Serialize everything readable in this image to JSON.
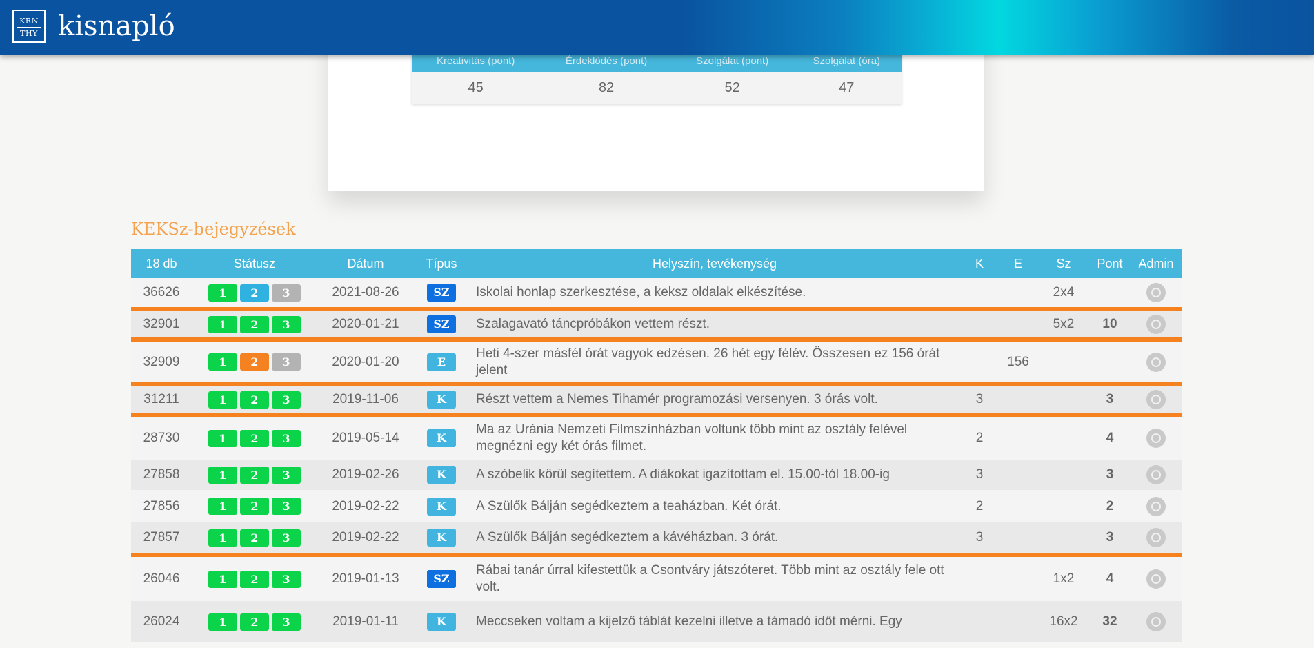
{
  "header": {
    "logo_top": "KRN",
    "logo_bottom": "THY",
    "title": "kisnapló"
  },
  "stats": {
    "headers": [
      "Kreativitás (pont)",
      "Érdeklődés (pont)",
      "Szolgálat (pont)",
      "Szolgálat (óra)"
    ],
    "values": [
      "45",
      "82",
      "52",
      "47"
    ]
  },
  "section": {
    "title": "KEKSz-bejegyzések"
  },
  "table": {
    "headers": {
      "count": "18 db",
      "status": "Státusz",
      "date": "Dátum",
      "type": "Típus",
      "desc": "Helyszín, tevékenység",
      "k": "K",
      "e": "E",
      "sz": "Sz",
      "pont": "Pont",
      "admin": "Admin"
    },
    "rows": [
      {
        "id": "36626",
        "s": [
          "1",
          "2",
          "3"
        ],
        "sc": [
          "green",
          "blue",
          "gray"
        ],
        "date": "2021-08-26",
        "type": "SZ",
        "desc": "Iskolai honlap szerkesztése, a keksz oldalak elkészítése.",
        "k": "",
        "e": "",
        "sz": "2x4",
        "pont": ""
      },
      {
        "id": "32901",
        "s": [
          "1",
          "2",
          "3"
        ],
        "sc": [
          "green",
          "green",
          "green"
        ],
        "date": "2020-01-21",
        "type": "SZ",
        "desc": "Szalagavató táncpróbákon vettem részt.",
        "k": "",
        "e": "",
        "sz": "5x2",
        "pont": "10"
      },
      {
        "id": "32909",
        "s": [
          "1",
          "2",
          "3"
        ],
        "sc": [
          "green",
          "orange",
          "gray"
        ],
        "date": "2020-01-20",
        "type": "E",
        "desc": "Heti 4-szer másfél órát vagyok edzésen. 26 hét egy félév. Összesen ez 156 órát jelent",
        "k": "",
        "e": "156",
        "sz": "",
        "pont": ""
      },
      {
        "id": "31211",
        "s": [
          "1",
          "2",
          "3"
        ],
        "sc": [
          "green",
          "green",
          "green"
        ],
        "date": "2019-11-06",
        "type": "K",
        "desc": "Részt vettem a Nemes Tihamér programozási versenyen. 3 órás volt.",
        "k": "3",
        "e": "",
        "sz": "",
        "pont": "3"
      },
      {
        "id": "28730",
        "s": [
          "1",
          "2",
          "3"
        ],
        "sc": [
          "green",
          "green",
          "green"
        ],
        "date": "2019-05-14",
        "type": "K",
        "desc": "Ma az Uránia Nemzeti Filmszínházban voltunk több mint az osztály felével megnézni egy két órás filmet.",
        "k": "2",
        "e": "",
        "sz": "",
        "pont": "4"
      },
      {
        "id": "27858",
        "s": [
          "1",
          "2",
          "3"
        ],
        "sc": [
          "green",
          "green",
          "green"
        ],
        "date": "2019-02-26",
        "type": "K",
        "desc": "A szóbelik körül segítettem. A diákokat igazítottam el. 15.00-tól 18.00-ig",
        "k": "3",
        "e": "",
        "sz": "",
        "pont": "3"
      },
      {
        "id": "27856",
        "s": [
          "1",
          "2",
          "3"
        ],
        "sc": [
          "green",
          "green",
          "green"
        ],
        "date": "2019-02-22",
        "type": "K",
        "desc": "A Szülők Bálján segédkeztem a teaházban. Két órát.",
        "k": "2",
        "e": "",
        "sz": "",
        "pont": "2"
      },
      {
        "id": "27857",
        "s": [
          "1",
          "2",
          "3"
        ],
        "sc": [
          "green",
          "green",
          "green"
        ],
        "date": "2019-02-22",
        "type": "K",
        "desc": "A Szülők Bálján segédkeztem a kávéházban. 3 órát.",
        "k": "3",
        "e": "",
        "sz": "",
        "pont": "3"
      },
      {
        "id": "26046",
        "s": [
          "1",
          "2",
          "3"
        ],
        "sc": [
          "green",
          "green",
          "green"
        ],
        "date": "2019-01-13",
        "type": "SZ",
        "desc": "Rábai tanár úrral kifestettük a Csontváry játszóteret. Több mint az osztály fele ott volt.",
        "k": "",
        "e": "",
        "sz": "1x2",
        "pont": "4"
      },
      {
        "id": "26024",
        "s": [
          "1",
          "2",
          "3"
        ],
        "sc": [
          "green",
          "green",
          "green"
        ],
        "date": "2019-01-11",
        "type": "K",
        "desc": "Meccseken voltam a kijelző táblát kezelni illetve a támadó időt mérni. Egy",
        "k": "",
        "e": "",
        "sz": "16x2",
        "pont": "32"
      }
    ],
    "row_classes": [
      "",
      "alt sep",
      "sep",
      "alt sep",
      "sep",
      "alt",
      "",
      "alt",
      "sep",
      "alt"
    ],
    "row_heights": [
      45,
      44,
      65,
      44,
      65,
      44,
      47,
      47,
      67,
      60
    ]
  }
}
